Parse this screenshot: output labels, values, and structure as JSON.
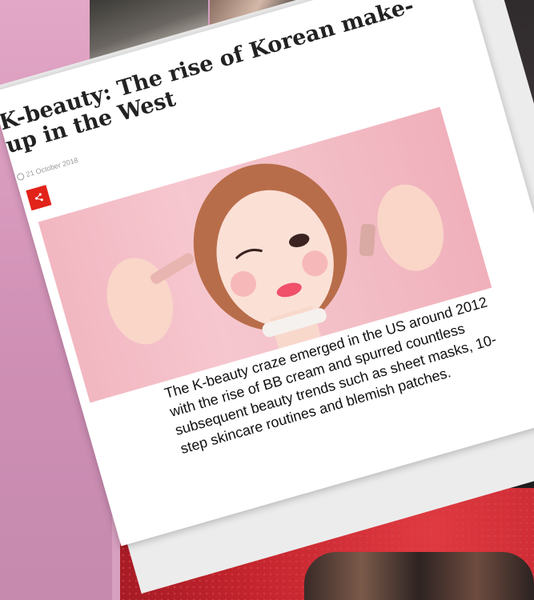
{
  "article": {
    "headline": "K-beauty: The rise of Korean make-up in the West",
    "date": "21 October 2018",
    "share_icon": "share-icon",
    "summary": "The K-beauty craze emerged in the US around 2012 with the rise of BB cream and spurred countless subsequent beauty trends such as sheet masks, 10-step skincare routines and blemish patches."
  },
  "colors": {
    "background_pink": "#d79fc0",
    "share_red": "#e2231a",
    "card_white": "#ffffff",
    "bottom_red": "#c3242d"
  }
}
